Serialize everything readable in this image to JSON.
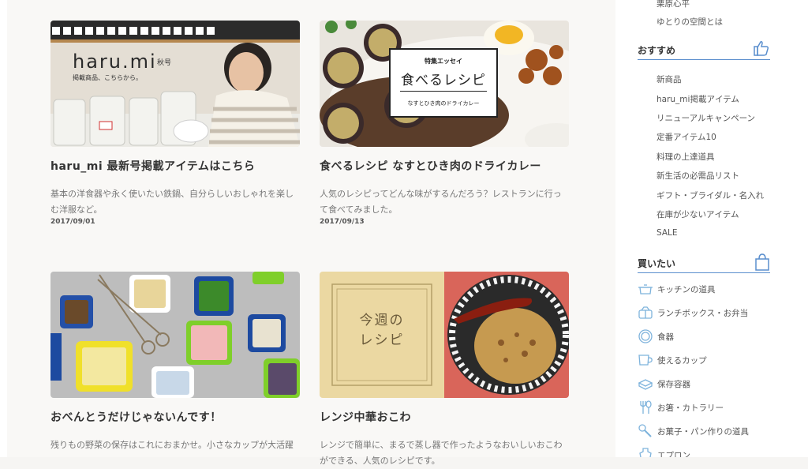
{
  "articles": [
    {
      "title": "haru_mi 最新号掲載アイテムはこちら",
      "desc": "基本の洋食器や永く使いたい鉄鍋、自分らしいおしゃれを楽しむ洋服など。",
      "date": "2017/09/01",
      "thumb": {
        "logo": "haru.mi",
        "issue": "秋号",
        "caption": "掲載商品、こちらから。"
      }
    },
    {
      "title": "食べるレシピ なすとひき肉のドライカレー",
      "desc": "人気のレシピってどんな味がするんだろう？レストランに行って食べてみました。",
      "date": "2017/09/13",
      "thumb": {
        "kicker": "特集エッセイ",
        "headline": "食べるレシピ",
        "sub": "なすとひき肉のドライカレー"
      }
    },
    {
      "title": "おべんとうだけじゃないんです！",
      "desc": "残りもの野菜の保存はこれにおまかせ。小さなカップが大活躍",
      "date": "",
      "thumb": {}
    },
    {
      "title": "レンジ中華おこわ",
      "desc": "レンジで簡単に、まるで蒸し器で作ったようなおいしいおこわができる、人気のレシピです。",
      "date": "",
      "thumb": {
        "overlay": "今週の\nレシピ"
      }
    }
  ],
  "sidebar": {
    "top_links": [
      "栗原心平",
      "ゆとりの空間とは"
    ],
    "recommend": {
      "heading": "おすすめ",
      "icon": "thumbs-up-icon",
      "items": [
        "新商品",
        "haru_mi掲載アイテム",
        "リニューアルキャンペーン",
        "定番アイテム10",
        "料理の上達道具",
        "新生活の必需品リスト",
        "ギフト・ブライダル・名入れ",
        "在庫が少ないアイテム",
        "SALE"
      ]
    },
    "buy": {
      "heading": "買いたい",
      "icon": "shopping-bag-icon",
      "items": [
        {
          "label": "キッチンの道具",
          "icon": "pot-icon"
        },
        {
          "label": "ランチボックス・お弁当",
          "icon": "lunchbox-icon"
        },
        {
          "label": "食器",
          "icon": "plate-icon"
        },
        {
          "label": "使えるカップ",
          "icon": "cup-icon"
        },
        {
          "label": "保存容器",
          "icon": "container-icon"
        },
        {
          "label": "お箸・カトラリー",
          "icon": "cutlery-icon"
        },
        {
          "label": "お菓子・パン作りの道具",
          "icon": "whisk-icon"
        },
        {
          "label": "エプロン",
          "icon": "apron-icon"
        }
      ]
    }
  },
  "colors": {
    "accent": "#5b8fce",
    "text": "#333333",
    "muted": "#777777",
    "icon": "#7eb3dc"
  }
}
